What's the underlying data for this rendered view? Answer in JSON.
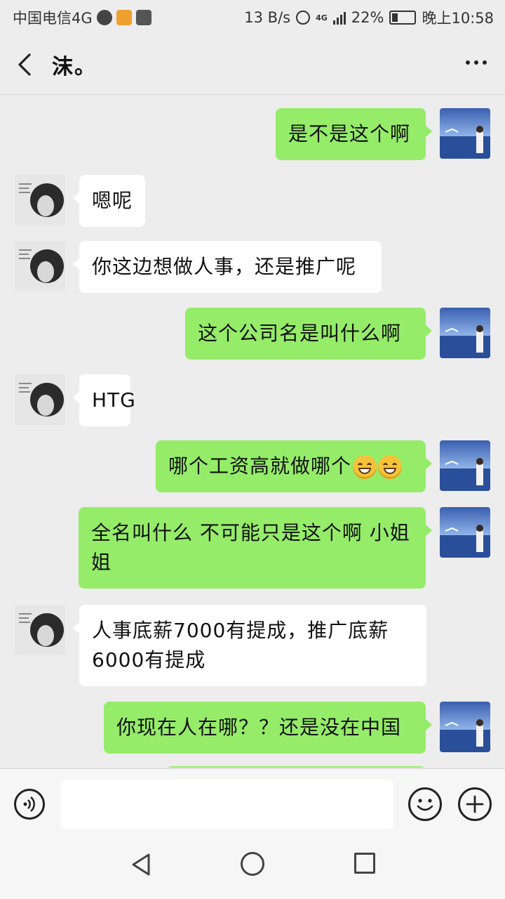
{
  "status_bar": {
    "carrier": "中国电信4G",
    "net_speed": "13 B/s",
    "network_type": "4G",
    "battery": "22%",
    "time": "晚上10:58"
  },
  "header": {
    "title": "沫。"
  },
  "messages": [
    {
      "side": "self",
      "text": "是不是这个啊"
    },
    {
      "side": "other",
      "text": "嗯呢"
    },
    {
      "side": "other",
      "text": "你这边想做人事，还是推广呢"
    },
    {
      "side": "self",
      "text": "这个公司名是叫什么啊"
    },
    {
      "side": "other",
      "text": "HTG"
    },
    {
      "side": "self",
      "text": "哪个工资高就做哪个",
      "emoji_count": 2
    },
    {
      "side": "self",
      "text": "全名叫什么 不可能只是这个啊 小姐姐"
    },
    {
      "side": "other",
      "text": "人事底薪7000有提成，推广底薪6000有提成"
    },
    {
      "side": "self",
      "text": "你现在人在哪？？还是没在中国"
    }
  ],
  "input_bar": {
    "placeholder": ""
  },
  "colors": {
    "self_bubble": "#95ec69",
    "other_bubble": "#ffffff",
    "background": "#ededed"
  }
}
